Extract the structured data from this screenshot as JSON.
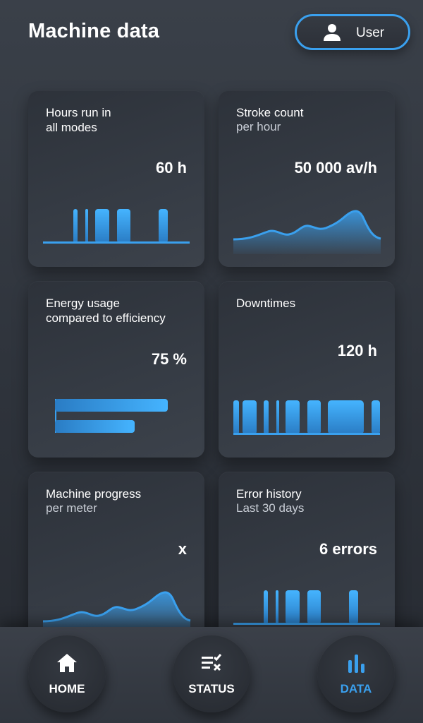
{
  "header": {
    "title": "Machine data",
    "user_label": "User"
  },
  "colors": {
    "accent": "#3aa0ee",
    "card_bg": "#343a43",
    "text": "#ffffff"
  },
  "cards": [
    {
      "title_line1": "Hours run in",
      "title_line2": "all modes",
      "value": "60 h",
      "chart": "bars"
    },
    {
      "title_line1": "Stroke count",
      "subtitle": "per hour",
      "value": "50 000 av/h",
      "chart": "area"
    },
    {
      "title_line1": "Energy usage",
      "title_line2": "compared to efficiency",
      "value": "75 %",
      "chart": "horizontal-bars"
    },
    {
      "title_line1": "Downtimes",
      "value": "120 h",
      "chart": "bars"
    },
    {
      "title_line1": "Machine progress",
      "subtitle": "per meter",
      "value": "x",
      "chart": "area"
    },
    {
      "title_line1": "Error history",
      "subtitle": "Last 30 days",
      "value": "6 errors",
      "chart": "bars"
    }
  ],
  "nav": {
    "home_label": "HOME",
    "status_label": "STATUS",
    "data_label": "DATA",
    "active": "DATA",
    "icons": [
      "home-icon",
      "checklist-icon",
      "bar-chart-icon"
    ]
  }
}
